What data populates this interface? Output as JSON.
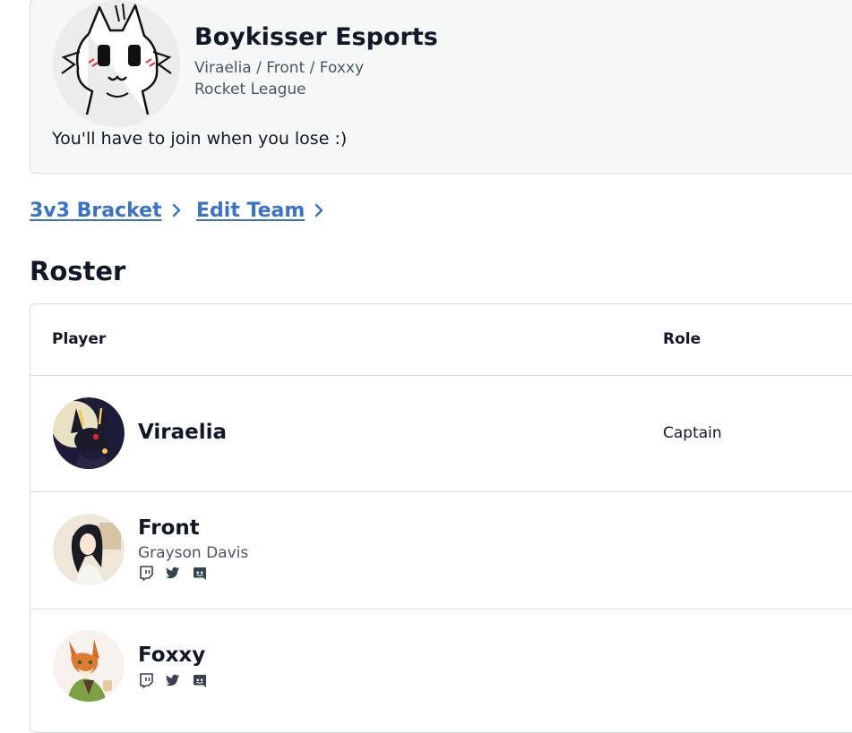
{
  "team": {
    "name": "Boykisser Esports",
    "players_line": "Viraelia / Front / Foxxy",
    "game": "Rocket League",
    "description": "You'll have to join when you lose :)",
    "logo_icon": "cartoon-cat-logo"
  },
  "nav": {
    "bracket": "3v3 Bracket",
    "edit": "Edit Team",
    "link_color": "#3b72c9"
  },
  "roster": {
    "title": "Roster",
    "columns": {
      "player": "Player",
      "role": "Role"
    },
    "players": [
      {
        "name": "Viraelia",
        "real_name": "",
        "role": "Captain",
        "avatar_icon": "umbreon-avatar",
        "socials": []
      },
      {
        "name": "Front",
        "real_name": "Grayson Davis",
        "role": "",
        "avatar_icon": "anime-girl-avatar",
        "socials": [
          "twitch-icon",
          "twitter-icon",
          "discord-icon"
        ]
      },
      {
        "name": "Foxxy",
        "real_name": "",
        "role": "",
        "avatar_icon": "fox-avatar",
        "socials": [
          "twitch-icon",
          "twitter-icon",
          "discord-icon"
        ]
      }
    ]
  },
  "colors": {
    "card_bg": "#f6f7f7",
    "border": "#d8dbdf",
    "text": "#111827",
    "muted": "#4b5563"
  }
}
